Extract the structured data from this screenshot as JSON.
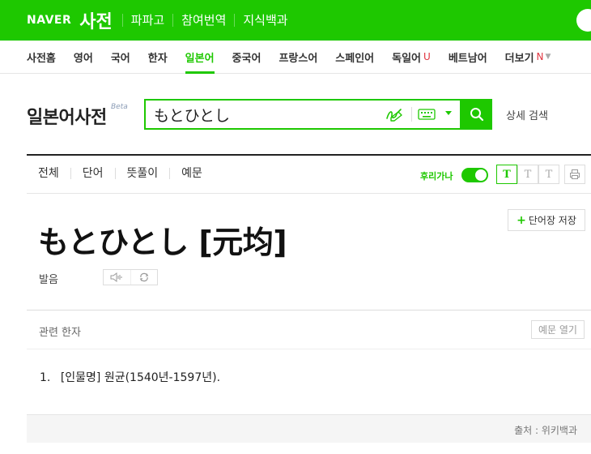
{
  "header": {
    "logo": "NAVER",
    "service": "사전",
    "nav": [
      "파파고",
      "참여번역",
      "지식백과"
    ]
  },
  "subnav": {
    "items": [
      {
        "label": "사전홈"
      },
      {
        "label": "영어"
      },
      {
        "label": "국어"
      },
      {
        "label": "한자"
      },
      {
        "label": "일본어",
        "active": true
      },
      {
        "label": "중국어"
      },
      {
        "label": "프랑스어"
      },
      {
        "label": "스페인어"
      },
      {
        "label": "독일어",
        "badge": "U"
      },
      {
        "label": "베트남어"
      },
      {
        "label": "더보기",
        "badge": "N"
      }
    ]
  },
  "dict": {
    "title": "일본어사전",
    "beta": "Beta"
  },
  "search": {
    "value": "もとひとし",
    "advanced_label": "상세 검색"
  },
  "filters": {
    "items": [
      "전체",
      "단어",
      "뜻풀이",
      "예문"
    ],
    "furigana_label": "후리가나",
    "furigana_on": true,
    "font_buttons": [
      "T",
      "T",
      "T"
    ]
  },
  "entry": {
    "title": "もとひとし [元均]",
    "wordbook_label": "단어장 저장",
    "pron_label": "발음"
  },
  "related": {
    "label": "관련 한자",
    "example_button": "예문 열기"
  },
  "meanings": [
    {
      "num": "1.",
      "text": "[인물명] 원균(1540년-1597년)."
    }
  ],
  "source": "출처 : 위키백과",
  "colors": {
    "brand": "#1ec800",
    "badge_red": "#e0343f"
  }
}
